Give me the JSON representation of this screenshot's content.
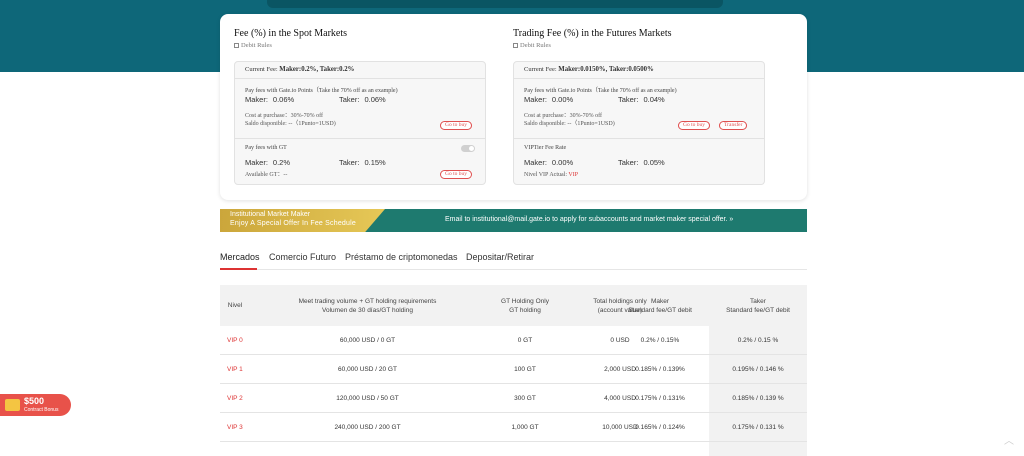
{
  "spot": {
    "title": "Fee (%) in the Spot Markets",
    "debit_rules": "Debit Rules",
    "current_fee_label": "Current Fee:",
    "current_fee_value": "Maker:0.2%,  Taker:0.2%",
    "points_label": "Pay fees with Gate.io Points（Take the 70% off as an example)",
    "points_maker_label": "Maker:",
    "points_maker_value": "0.06%",
    "points_taker_label": "Taker:",
    "points_taker_value": "0.06%",
    "cost_line": "Cost at purchase：30%-70% off",
    "saldo_line": "Saldo disponible:  --（1Punto=1USD)",
    "go_to_buy": "Go to buy",
    "gt_label": "Pay fees with GT",
    "gt_maker_label": "Maker:",
    "gt_maker_value": "0.2%",
    "gt_taker_label": "Taker:",
    "gt_taker_value": "0.15%",
    "available_gt": "Available GT：--",
    "gt_go_to_buy": "Go to buy"
  },
  "futures": {
    "title": "Trading Fee (%) in the Futures Markets",
    "debit_rules": "Debit Rules",
    "current_fee_label": "Current Fee:",
    "current_fee_value": "Maker:0.0150%,  Taker:0.0500%",
    "points_label": "Pay fees with Gate.io Points（Take the 70% off as an example)",
    "points_maker_label": "Maker:",
    "points_maker_value": "0.00%",
    "points_taker_label": "Taker:",
    "points_taker_value": "0.04%",
    "cost_line": "Cost at purchase：30%-70% off",
    "saldo_line": "Saldo disponible:  --（1Punto=1USD)",
    "go_to_buy": "Go to buy",
    "transfer": "Transfer",
    "vip_label": "VIPTier Fee Rate",
    "vip_maker_label": "Maker:",
    "vip_maker_value": "0.00%",
    "vip_taker_label": "Taker:",
    "vip_taker_value": "0.05%",
    "vip_level_label": "Nivel VIP Actual:",
    "vip_level_value": "VIP"
  },
  "banner": {
    "line1": "Institutional Market Maker",
    "line2": "Enjoy A Special Offer In Fee Schedule",
    "cta": "Email to institutional@mail.gate.io to apply for subaccounts and market maker special offer.  »"
  },
  "tabs": [
    "Mercados",
    "Comercio Futuro",
    "Préstamo de criptomonedas",
    "Depositar/Retirar"
  ],
  "table": {
    "headers": [
      "Nivel",
      "Meet trading volume + GT holding requirements\nVolumen de 30 días/GT holding",
      "GT Holding Only\nGT holding",
      "Total holdings only\n(account value)",
      "Maker\nStandard fee/GT debit",
      "Taker\nStandard fee/GT debit"
    ],
    "rows": [
      [
        "VIP 0",
        "60,000 USD / 0 GT",
        "0 GT",
        "0 USD",
        "0.2% / 0.15%",
        "0.2% / 0.15 %"
      ],
      [
        "VIP 1",
        "60,000 USD / 20 GT",
        "100 GT",
        "2,000 USD",
        "0.185% / 0.139%",
        "0.195% / 0.146 %"
      ],
      [
        "VIP 2",
        "120,000 USD / 50 GT",
        "300 GT",
        "4,000 USD",
        "0.175% / 0.131%",
        "0.185% / 0.139 %"
      ],
      [
        "VIP 3",
        "240,000 USD / 200 GT",
        "1,000 GT",
        "10,000 USD",
        "0.165% / 0.124%",
        "0.175% / 0.131 %"
      ]
    ]
  },
  "promo": {
    "amount": "$500",
    "label": "Contract Bonus"
  },
  "icons": {
    "debit_rules": "document-icon",
    "back_to_top": "chevron-up-icon"
  }
}
